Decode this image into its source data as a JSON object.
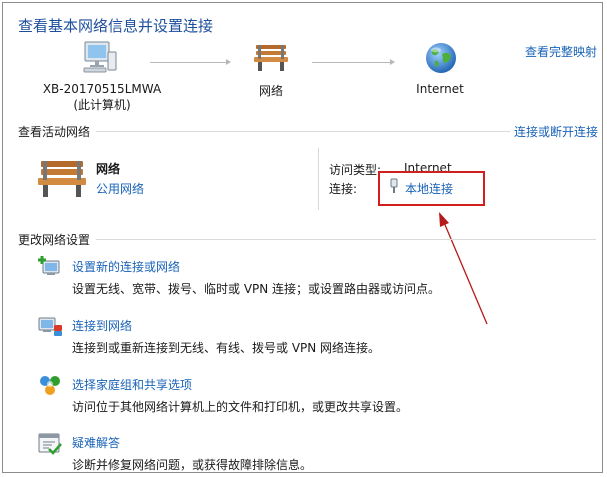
{
  "header": {
    "title": "查看基本网络信息并设置连接",
    "see_full_map": "查看完整映射"
  },
  "network_map": {
    "computer": {
      "name": "XB-20170515LMWA",
      "sub": "(此计算机)"
    },
    "network": {
      "name": "网络"
    },
    "internet": {
      "name": "Internet"
    }
  },
  "active_networks": {
    "heading": "查看活动网络",
    "connect_disconnect": "连接或断开连接",
    "network_name": "网络",
    "network_type": "公用网络",
    "access_type_label": "访问类型:",
    "access_type_value": "Internet",
    "connections_label": "连接:",
    "connection_value": "本地连接"
  },
  "change_settings": {
    "heading": "更改网络设置",
    "tasks": [
      {
        "title": "设置新的连接或网络",
        "desc": "设置无线、宽带、拨号、临时或 VPN 连接；或设置路由器或访问点。"
      },
      {
        "title": "连接到网络",
        "desc": "连接到或重新连接到无线、有线、拨号或 VPN 网络连接。"
      },
      {
        "title": "选择家庭组和共享选项",
        "desc": "访问位于其他网络计算机上的文件和打印机，或更改共享设置。"
      },
      {
        "title": "疑难解答",
        "desc": "诊断并修复网络问题，或获得故障排除信息。"
      }
    ]
  },
  "colors": {
    "title": "#1e4f9c",
    "link": "#1a63b8",
    "highlight": "#d11f1f",
    "arrow": "#b51a1a"
  }
}
